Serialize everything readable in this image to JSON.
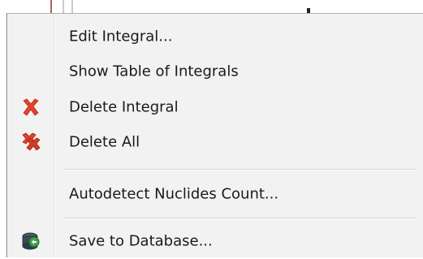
{
  "context_menu": {
    "items": [
      {
        "label": "Edit Integral..."
      },
      {
        "label": "Show Table of Integrals"
      },
      {
        "label": "Delete Integral",
        "icon": "red-x-icon"
      },
      {
        "label": "Delete All",
        "icon": "red-double-x-icon"
      },
      {
        "label": "Autodetect Nuclides Count..."
      },
      {
        "label": "Save to Database...",
        "icon": "database-save-icon"
      }
    ]
  },
  "colors": {
    "menu_background": "#f2f2f2",
    "delete_icon": "#e0432b",
    "text": "#1a1a1a"
  }
}
